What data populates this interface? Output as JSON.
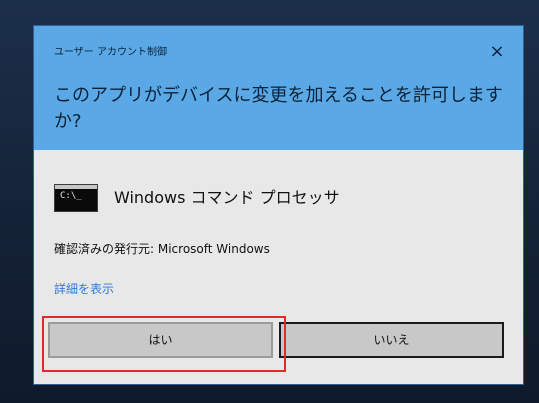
{
  "dialog": {
    "header_title": "ユーザー アカウント制御",
    "question": "このアプリがデバイスに変更を加えることを許可しますか?",
    "close_glyph": "×",
    "app": {
      "icon": "cmd-window-icon",
      "name": "Windows コマンド プロセッサ"
    },
    "publisher_line": "確認済みの発行元: Microsoft Windows",
    "details_link": "詳細を表示",
    "buttons": {
      "yes": "はい",
      "no": "いいえ"
    }
  },
  "colors": {
    "header_bg": "#5aa9e6",
    "dialog_bg": "#e8e8e8",
    "link": "#2b7bd6",
    "highlight": "#e02b2b"
  }
}
